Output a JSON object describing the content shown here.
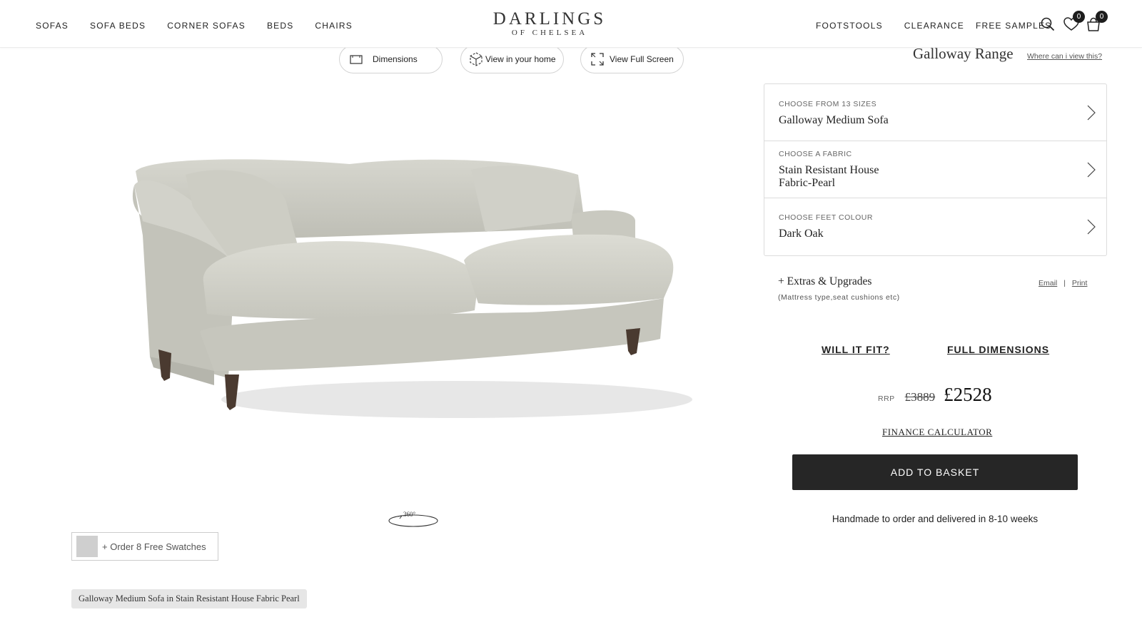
{
  "header": {
    "logo_main": "DARLINGS",
    "logo_sub": "OF CHELSEA",
    "nav_left": [
      "SOFAS",
      "SOFA BEDS",
      "CORNER SOFAS",
      "BEDS",
      "CHAIRS"
    ],
    "nav_right": [
      "FOOTSTOOLS",
      "CLEARANCE",
      "FREE SAMPLES"
    ],
    "wishlist_count": "0",
    "basket_count": "0"
  },
  "viewer": {
    "dimensions_label": "Dimensions",
    "view_home_label": "View in your home",
    "full_screen_label": "View Full Screen",
    "rotate_label": "360°"
  },
  "swatches": {
    "label": "+ Order 8 Free Swatches"
  },
  "caption": "Galloway Medium Sofa in Stain Resistant House Fabric Pearl",
  "product": {
    "range_title": "Galloway Range",
    "where_link": "Where can i view this?",
    "options": [
      {
        "label": "CHOOSE FROM 13 SIZES",
        "value_line1": "Galloway Medium Sofa",
        "value_line2": ""
      },
      {
        "label": "CHOOSE A FABRIC",
        "value_line1": "Stain Resistant House",
        "value_line2": "Fabric-Pearl"
      },
      {
        "label": "CHOOSE FEET COLOUR",
        "value_line1": "Dark Oak",
        "value_line2": ""
      }
    ],
    "extras_title": "+ Extras & Upgrades",
    "extras_sub": "(Mattress type,seat cushions etc)",
    "email_label": "Email",
    "print_label": "Print",
    "will_it_fit": "WILL IT FIT?",
    "full_dimensions": "FULL DIMENSIONS",
    "rrp_label": "RRP",
    "old_price": "£3889",
    "new_price": "£2528",
    "finance_label": "FINANCE CALCULATOR",
    "basket_label": "ADD TO BASKET",
    "delivery_text": "Handmade to order and delivered in 8-10 weeks"
  },
  "colors": {
    "button_dark": "#262626",
    "fabric": "#cfcfc6"
  }
}
